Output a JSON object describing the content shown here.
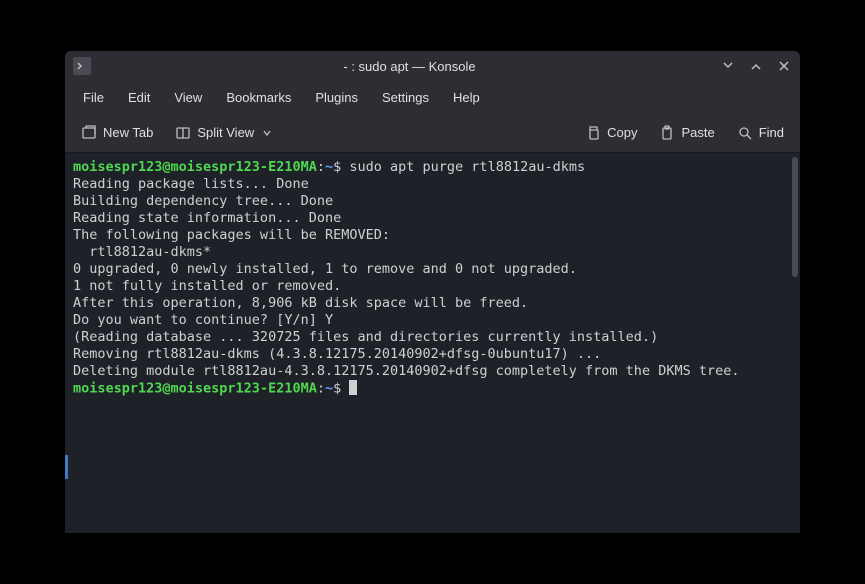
{
  "window": {
    "title": "- : sudo apt — Konsole"
  },
  "menubar": {
    "items": [
      "File",
      "Edit",
      "View",
      "Bookmarks",
      "Plugins",
      "Settings",
      "Help"
    ]
  },
  "toolbar": {
    "new_tab": "New Tab",
    "split_view": "Split View",
    "copy": "Copy",
    "paste": "Paste",
    "find": "Find"
  },
  "terminal": {
    "prompt_user_host": "moisespr123@moisespr123-E210MA",
    "prompt_sep1": ":",
    "prompt_path": "~",
    "prompt_sep2": "$",
    "command1": " sudo apt purge rtl8812au-dkms",
    "lines": [
      "Reading package lists... Done",
      "Building dependency tree... Done",
      "Reading state information... Done",
      "The following packages will be REMOVED:",
      "  rtl8812au-dkms*",
      "0 upgraded, 0 newly installed, 1 to remove and 0 not upgraded.",
      "1 not fully installed or removed.",
      "After this operation, 8,906 kB disk space will be freed.",
      "Do you want to continue? [Y/n] Y",
      "(Reading database ... 320725 files and directories currently installed.)",
      "Removing rtl8812au-dkms (4.3.8.12175.20140902+dfsg-0ubuntu17) ...",
      "Deleting module rtl8812au-4.3.8.12175.20140902+dfsg completely from the DKMS tree."
    ]
  }
}
